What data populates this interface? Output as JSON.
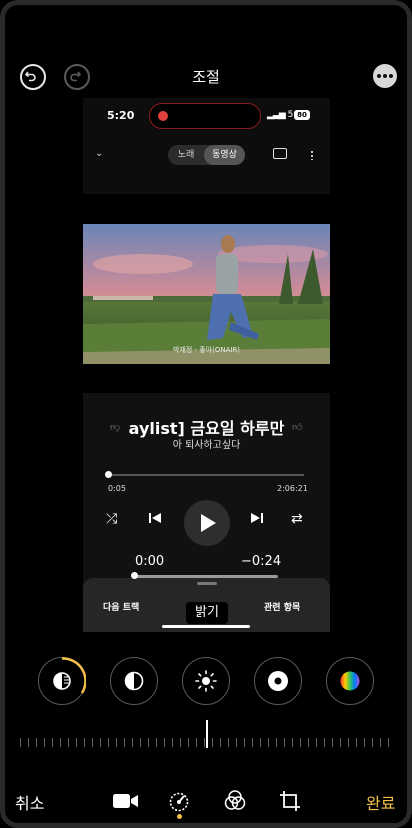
{
  "header": {
    "title": "조절",
    "undo_icon": "undo-icon",
    "redo_icon": "redo-icon",
    "more_icon": "more-icon"
  },
  "preview": {
    "status": {
      "time": "5:20",
      "network": "5G",
      "battery": "80"
    },
    "segment": {
      "song": "노래",
      "video": "동영상"
    },
    "video_caption": "박재정 - 좋아(ONAIR)",
    "song_title": "aylist] 금요일 하루만",
    "song_artist": "아 퇴사하고싶다",
    "time_start": "0:05",
    "time_end": "2:06:21",
    "progress_fraction": 0.002,
    "edit_time_start": "0:00",
    "edit_time_remaining": "−0:24",
    "tabs": {
      "next": "다음 트랙",
      "related": "관련 항목"
    }
  },
  "tooltip": "밝기",
  "tools": [
    {
      "name": "exposure-icon",
      "active": true
    },
    {
      "name": "contrast-icon",
      "active": false
    },
    {
      "name": "brightness-icon",
      "active": false
    },
    {
      "name": "vignette-icon",
      "active": false
    },
    {
      "name": "color-icon",
      "active": false
    }
  ],
  "bottom": {
    "cancel": "취소",
    "done": "완료",
    "accent": "#f5c04a"
  }
}
